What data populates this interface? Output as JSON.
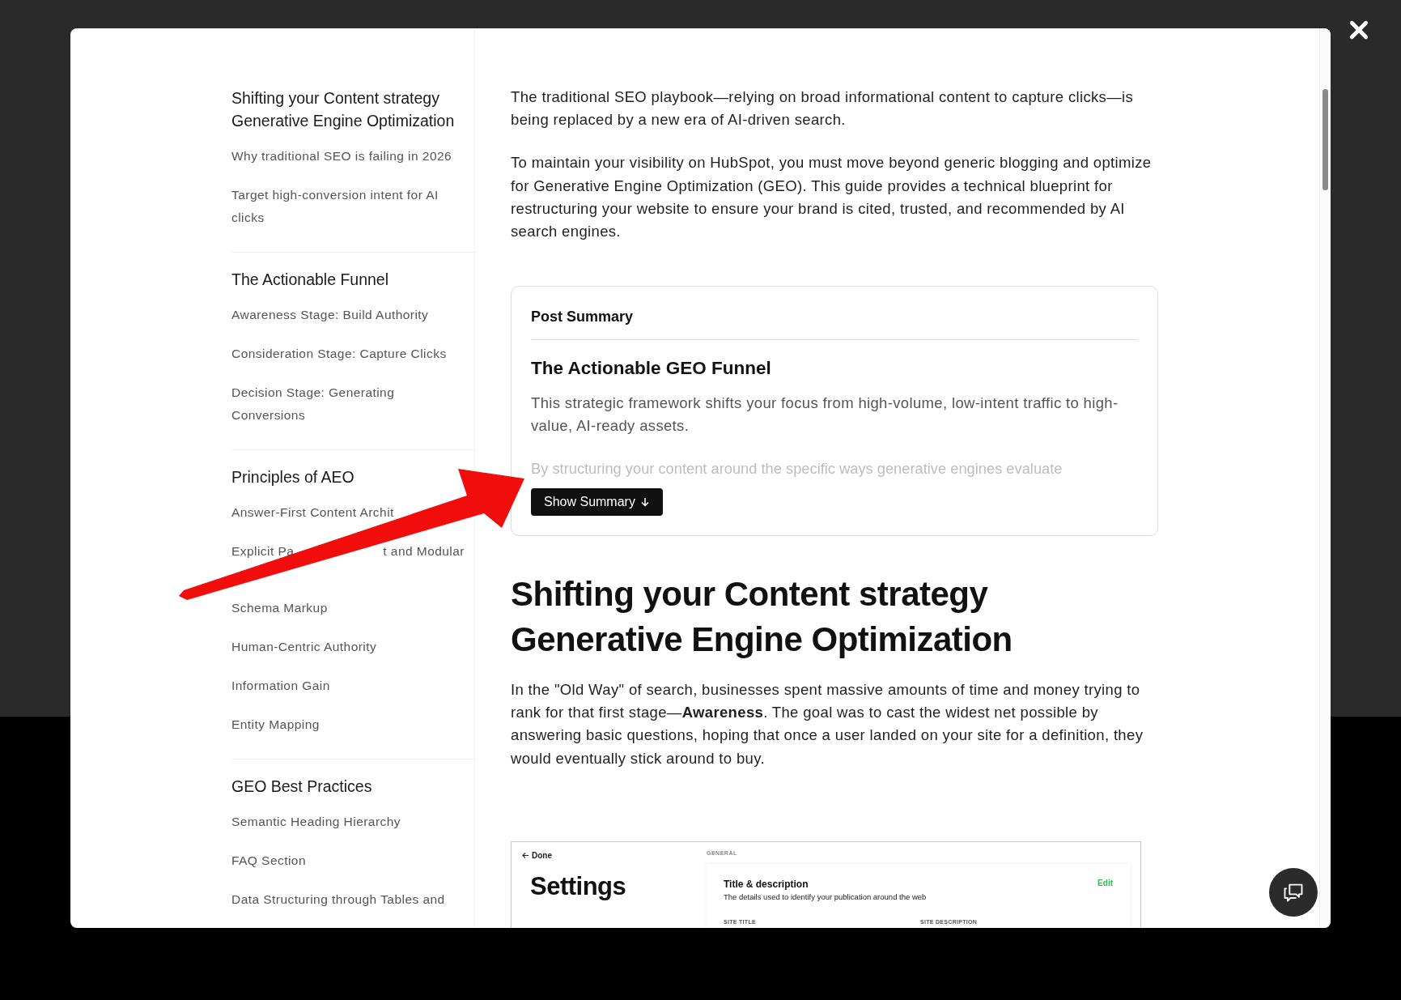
{
  "sidebar": {
    "groups": [
      {
        "heading": "Shifting your Content strategy Generative Engine Optimization",
        "items": [
          {
            "kind": "link",
            "text": "Why traditional SEO is failing in 2026"
          },
          {
            "kind": "link",
            "text": "Target high-conversion intent for AI clicks"
          }
        ]
      },
      {
        "heading": "The Actionable Funnel",
        "items": [
          {
            "kind": "link",
            "text": "Awareness Stage: Build Authority"
          },
          {
            "kind": "link",
            "text": "Consideration Stage: Capture Clicks"
          },
          {
            "kind": "link",
            "text": "Decision Stage: Generating Conversions"
          }
        ]
      },
      {
        "heading": "Principles of AEO",
        "items": [
          {
            "kind": "link",
            "text": "Answer-First Content Archit"
          },
          {
            "kind": "covered",
            "segments": [
              "Explicit Pa",
              "t and Modular"
            ]
          },
          {
            "kind": "link",
            "text": "Schema Markup"
          },
          {
            "kind": "link",
            "text": "Human-Centric Authority"
          },
          {
            "kind": "link",
            "text": "Information Gain"
          },
          {
            "kind": "link",
            "text": "Entity Mapping"
          }
        ]
      },
      {
        "heading": "GEO Best Practices",
        "items": [
          {
            "kind": "link",
            "text": "Semantic Heading Hierarchy"
          },
          {
            "kind": "link",
            "text": "FAQ Section"
          },
          {
            "kind": "link",
            "text": "Data Structuring through Tables and"
          }
        ]
      }
    ]
  },
  "article": {
    "intro": [
      "The traditional SEO playbook—relying on broad informational content to capture clicks—is being replaced by a new era of AI-driven search.",
      "To maintain your visibility on HubSpot, you must move beyond generic blogging and optimize for Generative Engine Optimization (GEO). This guide provides a technical blueprint for restructuring your website to ensure your brand is cited, trusted, and recommended by AI search engines."
    ],
    "summary": {
      "label": "Post Summary",
      "title": "The Actionable GEO Funnel",
      "text": "This strategic framework shifts your focus from high-volume, low-intent traffic to high-value, AI-ready assets.",
      "faded_text": "By structuring your content around the specific ways generative engines evaluate",
      "button": "Show Summary",
      "expanded": false
    },
    "heading": "Shifting your Content strategy Generative Engine Optimization",
    "body": "In the \"Old Way\" of search, businesses spent massive amounts of time and money trying to rank for that first stage—**Awareness**. The goal was to cast the widest net possible by answering basic questions, hoping that once a user landed on your site for a definition, they would eventually stick around to buy.",
    "screenshot": {
      "back": "Done",
      "title": "Settings",
      "section": "GENERAL",
      "card_title": "Title & description",
      "card_text": "The details used to identify your publication around the web",
      "edit": "Edit",
      "field_1": "SITE TITLE",
      "field_2": "SITE DESCRIPTION"
    }
  }
}
